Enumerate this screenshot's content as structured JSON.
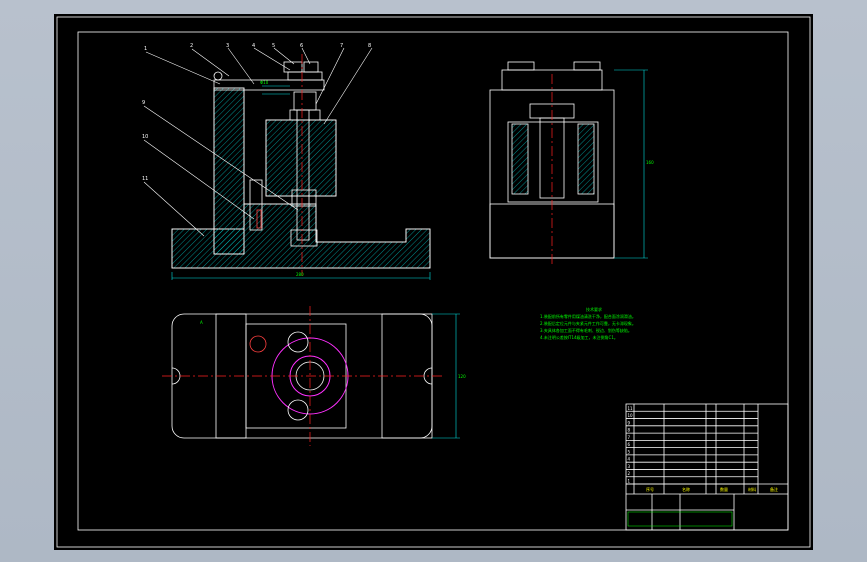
{
  "drawing": {
    "background": "#000000",
    "frame_color": "#ffffff",
    "balloon_numbers": [
      "1",
      "2",
      "3",
      "4",
      "5",
      "6",
      "7",
      "8",
      "9",
      "10",
      "11"
    ],
    "notes_title": "技术要求",
    "notes_lines": [
      "1.装配前所有零件用煤油清洗干净，配合面涂润滑油。",
      "2.装配后定位元件与夹紧元件工作可靠，无卡滞现象。",
      "3.夹具体各加工面不得有毛刺、锐边、划伤等缺陷。",
      "4.未注明公差按IT14级加工，未注倒角C1。"
    ],
    "title_block": {
      "cells_left": [
        "11",
        "10",
        "9",
        "8",
        "7",
        "6",
        "5",
        "4",
        "3",
        "2",
        "1"
      ],
      "foot_labels": [
        "序号",
        "名称",
        "数量",
        "材料",
        "备注"
      ]
    }
  }
}
